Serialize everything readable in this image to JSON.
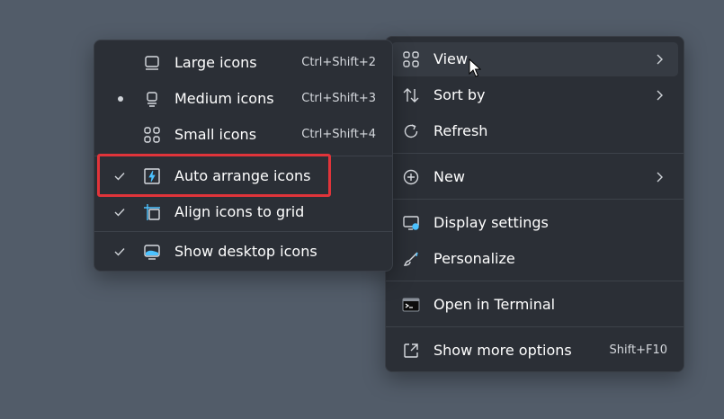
{
  "main_menu": {
    "items": [
      {
        "label": "View",
        "icon": "grid-icon",
        "has_submenu": true
      },
      {
        "label": "Sort by",
        "icon": "sort-icon",
        "has_submenu": true
      },
      {
        "label": "Refresh",
        "icon": "refresh-icon"
      },
      {
        "label": "New",
        "icon": "plus-circle-icon",
        "has_submenu": true
      },
      {
        "label": "Display settings",
        "icon": "display-settings-icon"
      },
      {
        "label": "Personalize",
        "icon": "brush-icon"
      },
      {
        "label": "Open in Terminal",
        "icon": "terminal-icon"
      },
      {
        "label": "Show more options",
        "icon": "expand-icon",
        "shortcut": "Shift+F10"
      }
    ]
  },
  "view_submenu": {
    "items": [
      {
        "label": "Large icons",
        "icon": "large-icons-icon",
        "shortcut": "Ctrl+Shift+2"
      },
      {
        "label": "Medium icons",
        "icon": "medium-icons-icon",
        "shortcut": "Ctrl+Shift+3",
        "selected": true
      },
      {
        "label": "Small icons",
        "icon": "small-icons-icon",
        "shortcut": "Ctrl+Shift+4"
      },
      {
        "label": "Auto arrange icons",
        "icon": "auto-arrange-icon",
        "checked": true
      },
      {
        "label": "Align icons to grid",
        "icon": "align-grid-icon",
        "checked": true
      },
      {
        "label": "Show desktop icons",
        "icon": "desktop-icons-icon",
        "checked": true
      }
    ]
  },
  "colors": {
    "desktop": "#525c69",
    "menu_bg": "#2b2f36",
    "hover": "#363b43",
    "accent": "#4cc2ff",
    "highlight": "#e0343a"
  }
}
